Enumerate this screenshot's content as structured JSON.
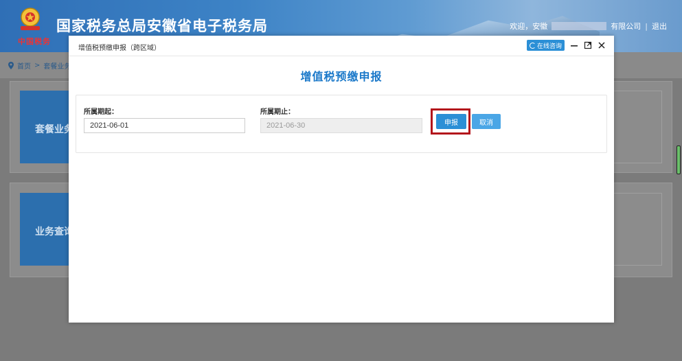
{
  "header": {
    "site_title": "国家税务总局安徽省电子税务局",
    "slogan": "中国税务",
    "welcome": "欢迎，安徽",
    "company_suffix": "有限公司",
    "separator": "|",
    "logout": "退出"
  },
  "breadcrumb": {
    "home": "首页",
    "separator": ">",
    "current": "套餐业务"
  },
  "background": {
    "tile1": "套餐业务",
    "tile2": "业务查询"
  },
  "modal": {
    "window_title": "增值税预缴申报（跨区域）",
    "consult_label": "在线咨询",
    "form_title": "增值税预缴申报",
    "start_label": "所属期起：",
    "start_value": "2021-06-01",
    "end_label": "所属期止：",
    "end_value": "2021-06-30",
    "submit_label": "申报",
    "cancel_label": "取消"
  },
  "colors": {
    "accent": "#2b8fd6",
    "title_blue": "#1a78c9",
    "highlight": "#b3131b",
    "header_blue": "#3d83c6"
  }
}
